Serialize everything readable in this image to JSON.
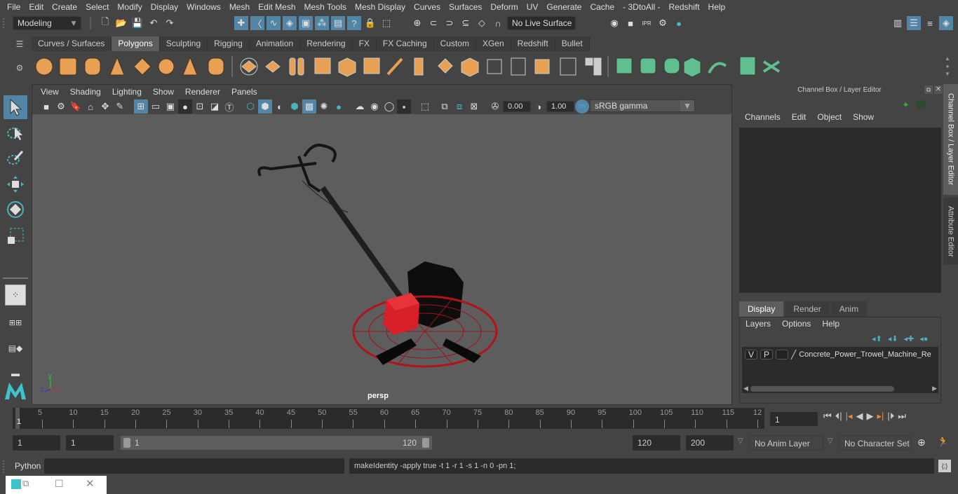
{
  "menubar": {
    "items": [
      "File",
      "Edit",
      "Create",
      "Select",
      "Modify",
      "Display",
      "Windows",
      "Mesh",
      "Edit Mesh",
      "Mesh Tools",
      "Mesh Display",
      "Curves",
      "Surfaces",
      "Deform",
      "UV",
      "Generate",
      "Cache",
      "- 3DtoAll -",
      "Redshift",
      "Help"
    ]
  },
  "statusline": {
    "mode": "Modeling",
    "live_surface": "No Live Surface"
  },
  "shelf": {
    "tabs": [
      "Curves / Surfaces",
      "Polygons",
      "Sculpting",
      "Rigging",
      "Animation",
      "Rendering",
      "FX",
      "FX Caching",
      "Custom",
      "XGen",
      "Redshift",
      "Bullet"
    ],
    "active_tab": "Polygons"
  },
  "viewport": {
    "menu": [
      "View",
      "Shading",
      "Lighting",
      "Show",
      "Renderer",
      "Panels"
    ],
    "exposure": "0.00",
    "gamma": "1.00",
    "color_space": "sRGB gamma",
    "camera_label": "persp",
    "axis": {
      "x": "x",
      "y": "y",
      "z": "z"
    }
  },
  "channel_box": {
    "title": "Channel Box / Layer Editor",
    "menu": [
      "Channels",
      "Edit",
      "Object",
      "Show"
    ]
  },
  "layer_editor": {
    "tabs": [
      "Display",
      "Render",
      "Anim"
    ],
    "active_tab": "Display",
    "menu": [
      "Layers",
      "Options",
      "Help"
    ],
    "layers": [
      {
        "v": "V",
        "p": "P",
        "name": "Concrete_Power_Trowel_Machine_Re"
      }
    ]
  },
  "side_tabs": [
    "Channel Box / Layer Editor",
    "Attribute Editor"
  ],
  "timeline": {
    "ticks": [
      "5",
      "10",
      "15",
      "20",
      "25",
      "30",
      "35",
      "40",
      "45",
      "50",
      "55",
      "60",
      "65",
      "70",
      "75",
      "80",
      "85",
      "90",
      "95",
      "100",
      "105",
      "110",
      "115",
      "12"
    ],
    "current_frame_marker": "1",
    "current_frame": "1"
  },
  "range": {
    "start": "1",
    "playback_start": "1",
    "slider_start": "1",
    "slider_end": "120",
    "playback_end": "120",
    "end": "200",
    "anim_layer": "No Anim Layer",
    "character_set": "No Character Set"
  },
  "command": {
    "language": "Python",
    "input": "",
    "result": "makeIdentity -apply true -t 1 -r 1 -s 1 -n 0 -pn 1;"
  }
}
